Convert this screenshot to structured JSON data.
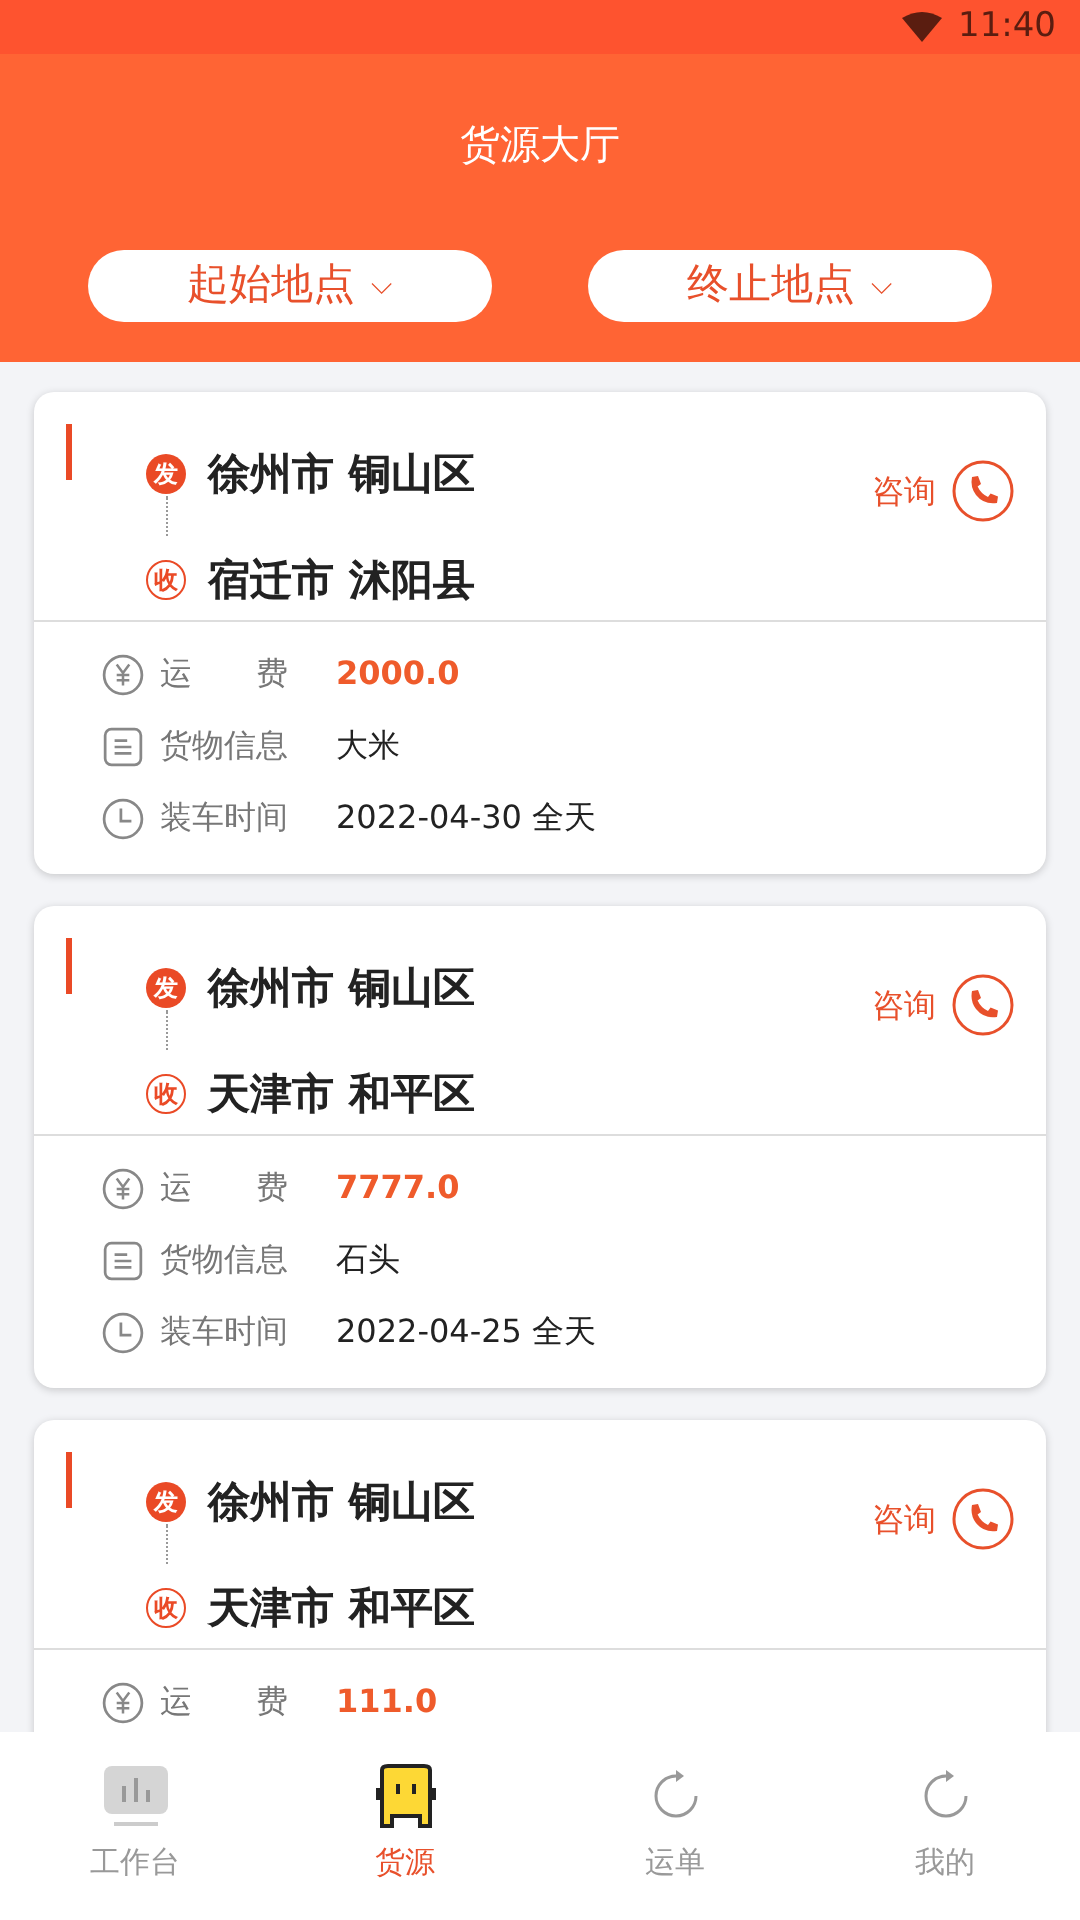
{
  "status_bar": {
    "time": "11:40"
  },
  "header": {
    "title": "货源大厅"
  },
  "filters": [
    {
      "label": "起始地点",
      "caret": "⌵"
    },
    {
      "label": "终止地点",
      "caret": "⌵"
    }
  ],
  "cards": [
    {
      "from_mark": "发",
      "to_mark": "收",
      "from": "徐州市 铜山区",
      "to": "宿迁市 沭阳县",
      "action": "咨询",
      "details": [
        {
          "kind": "fee",
          "label": "运　　费",
          "value": "2000.0"
        },
        {
          "kind": "goods",
          "label": "货物信息",
          "value": "大米"
        },
        {
          "kind": "time",
          "label": "装车时间",
          "value": "2022-04-30 全天"
        }
      ]
    },
    {
      "from_mark": "发",
      "to_mark": "收",
      "from": "徐州市 铜山区",
      "to": "天津市 和平区",
      "action": "咨询",
      "details": [
        {
          "kind": "fee",
          "label": "运　　费",
          "value": "7777.0"
        },
        {
          "kind": "goods",
          "label": "货物信息",
          "value": "石头"
        },
        {
          "kind": "time",
          "label": "装车时间",
          "value": "2022-04-25 全天"
        }
      ]
    },
    {
      "from_mark": "发",
      "to_mark": "收",
      "from": "徐州市 铜山区",
      "to": "天津市 和平区",
      "action": "咨询",
      "details": [
        {
          "kind": "fee",
          "label": "运　　费",
          "value": "111.0"
        }
      ]
    }
  ],
  "tab_bar": [
    {
      "kind": "chart",
      "label": "工作台",
      "selected": false
    },
    {
      "kind": "box",
      "label": "货源",
      "selected": true
    },
    {
      "kind": "cycle",
      "label": "运单",
      "selected": false
    },
    {
      "kind": "cycle",
      "label": "我的",
      "selected": false
    }
  ]
}
